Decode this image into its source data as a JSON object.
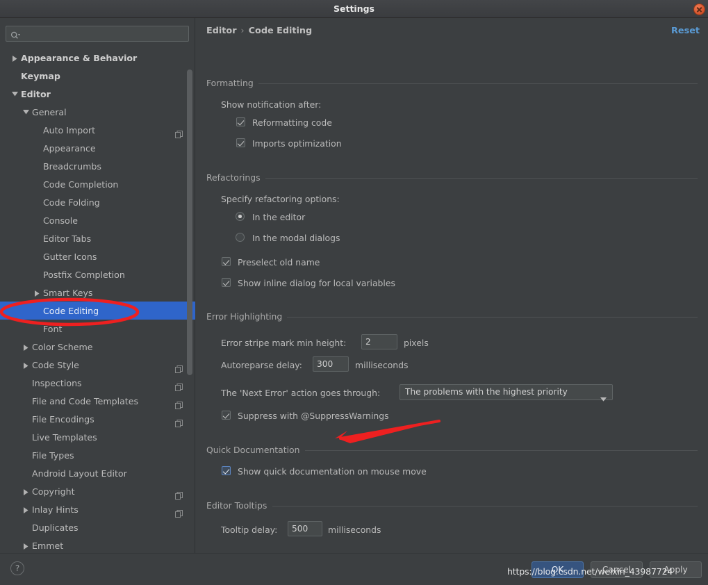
{
  "window": {
    "title": "Settings",
    "close_icon": "close-icon"
  },
  "sidebar": {
    "search": {
      "placeholder": "",
      "value": "",
      "icon": "search-icon"
    },
    "items": [
      {
        "label": "Appearance & Behavior",
        "indent": 0,
        "arrow": "collapsed",
        "bold": true,
        "selected": false,
        "side_icon": false
      },
      {
        "label": "Keymap",
        "indent": 0,
        "arrow": "none",
        "bold": true,
        "selected": false,
        "side_icon": false
      },
      {
        "label": "Editor",
        "indent": 0,
        "arrow": "expanded",
        "bold": true,
        "selected": false,
        "side_icon": false
      },
      {
        "label": "General",
        "indent": 1,
        "arrow": "expanded",
        "bold": false,
        "selected": false,
        "side_icon": false
      },
      {
        "label": "Auto Import",
        "indent": 2,
        "arrow": "none",
        "bold": false,
        "selected": false,
        "side_icon": true
      },
      {
        "label": "Appearance",
        "indent": 2,
        "arrow": "none",
        "bold": false,
        "selected": false,
        "side_icon": false
      },
      {
        "label": "Breadcrumbs",
        "indent": 2,
        "arrow": "none",
        "bold": false,
        "selected": false,
        "side_icon": false
      },
      {
        "label": "Code Completion",
        "indent": 2,
        "arrow": "none",
        "bold": false,
        "selected": false,
        "side_icon": false
      },
      {
        "label": "Code Folding",
        "indent": 2,
        "arrow": "none",
        "bold": false,
        "selected": false,
        "side_icon": false
      },
      {
        "label": "Console",
        "indent": 2,
        "arrow": "none",
        "bold": false,
        "selected": false,
        "side_icon": false
      },
      {
        "label": "Editor Tabs",
        "indent": 2,
        "arrow": "none",
        "bold": false,
        "selected": false,
        "side_icon": false
      },
      {
        "label": "Gutter Icons",
        "indent": 2,
        "arrow": "none",
        "bold": false,
        "selected": false,
        "side_icon": false
      },
      {
        "label": "Postfix Completion",
        "indent": 2,
        "arrow": "none",
        "bold": false,
        "selected": false,
        "side_icon": false
      },
      {
        "label": "Smart Keys",
        "indent": 2,
        "arrow": "collapsed",
        "bold": false,
        "selected": false,
        "side_icon": false
      },
      {
        "label": "Code Editing",
        "indent": 2,
        "arrow": "none",
        "bold": false,
        "selected": true,
        "side_icon": false
      },
      {
        "label": "Font",
        "indent": 2,
        "arrow": "none",
        "bold": false,
        "selected": false,
        "side_icon": false
      },
      {
        "label": "Color Scheme",
        "indent": 1,
        "arrow": "collapsed",
        "bold": false,
        "selected": false,
        "side_icon": false
      },
      {
        "label": "Code Style",
        "indent": 1,
        "arrow": "collapsed",
        "bold": false,
        "selected": false,
        "side_icon": true
      },
      {
        "label": "Inspections",
        "indent": 1,
        "arrow": "none",
        "bold": false,
        "selected": false,
        "side_icon": true
      },
      {
        "label": "File and Code Templates",
        "indent": 1,
        "arrow": "none",
        "bold": false,
        "selected": false,
        "side_icon": true
      },
      {
        "label": "File Encodings",
        "indent": 1,
        "arrow": "none",
        "bold": false,
        "selected": false,
        "side_icon": true
      },
      {
        "label": "Live Templates",
        "indent": 1,
        "arrow": "none",
        "bold": false,
        "selected": false,
        "side_icon": false
      },
      {
        "label": "File Types",
        "indent": 1,
        "arrow": "none",
        "bold": false,
        "selected": false,
        "side_icon": false
      },
      {
        "label": "Android Layout Editor",
        "indent": 1,
        "arrow": "none",
        "bold": false,
        "selected": false,
        "side_icon": false
      },
      {
        "label": "Copyright",
        "indent": 1,
        "arrow": "collapsed",
        "bold": false,
        "selected": false,
        "side_icon": true
      },
      {
        "label": "Inlay Hints",
        "indent": 1,
        "arrow": "collapsed",
        "bold": false,
        "selected": false,
        "side_icon": true
      },
      {
        "label": "Duplicates",
        "indent": 1,
        "arrow": "none",
        "bold": false,
        "selected": false,
        "side_icon": false
      },
      {
        "label": "Emmet",
        "indent": 1,
        "arrow": "collapsed",
        "bold": false,
        "selected": false,
        "side_icon": false
      }
    ]
  },
  "header": {
    "breadcrumb_root": "Editor",
    "breadcrumb_sep": "›",
    "breadcrumb_leaf": "Code Editing",
    "reset_label": "Reset"
  },
  "sections": {
    "formatting": {
      "title": "Formatting",
      "show_notification_label": "Show notification after:",
      "reformatting_code": {
        "label": "Reformatting code",
        "checked": true
      },
      "imports_optimization": {
        "label": "Imports optimization",
        "checked": true
      }
    },
    "refactorings": {
      "title": "Refactorings",
      "specify_label": "Specify refactoring options:",
      "in_the_editor": {
        "label": "In the editor",
        "checked": true
      },
      "in_the_modal_dialogs": {
        "label": "In the modal dialogs",
        "checked": false
      },
      "preselect_old_name": {
        "label": "Preselect old name",
        "checked": true
      },
      "show_inline_dialog": {
        "label": "Show inline dialog for local variables",
        "checked": true
      }
    },
    "error_highlighting": {
      "title": "Error Highlighting",
      "stripe_label": "Error stripe mark min height:",
      "stripe_value": "2",
      "stripe_unit": "pixels",
      "autoreparse_label": "Autoreparse delay:",
      "autoreparse_value": "300",
      "autoreparse_unit": "milliseconds",
      "next_error_label": "The 'Next Error' action goes through:",
      "next_error_value": "The problems with the highest priority",
      "suppress": {
        "label": "Suppress with @SuppressWarnings",
        "checked": true
      }
    },
    "quick_documentation": {
      "title": "Quick Documentation",
      "show_quick_doc": {
        "label": "Show quick documentation on mouse move",
        "checked": true
      }
    },
    "editor_tooltips": {
      "title": "Editor Tooltips",
      "tooltip_delay_label": "Tooltip delay:",
      "tooltip_delay_value": "500",
      "tooltip_delay_unit": "milliseconds"
    }
  },
  "footer": {
    "help_label": "?",
    "ok_label": "OK",
    "cancel_label": "Cancel",
    "apply_label": "Apply",
    "watermark_text": "https://blog.csdn.net/weixin_43987724"
  },
  "annotations": {
    "accent_red": "#ee2020",
    "ellipse_target": "Code Editing",
    "arrow_target": "Show quick documentation on mouse move"
  }
}
